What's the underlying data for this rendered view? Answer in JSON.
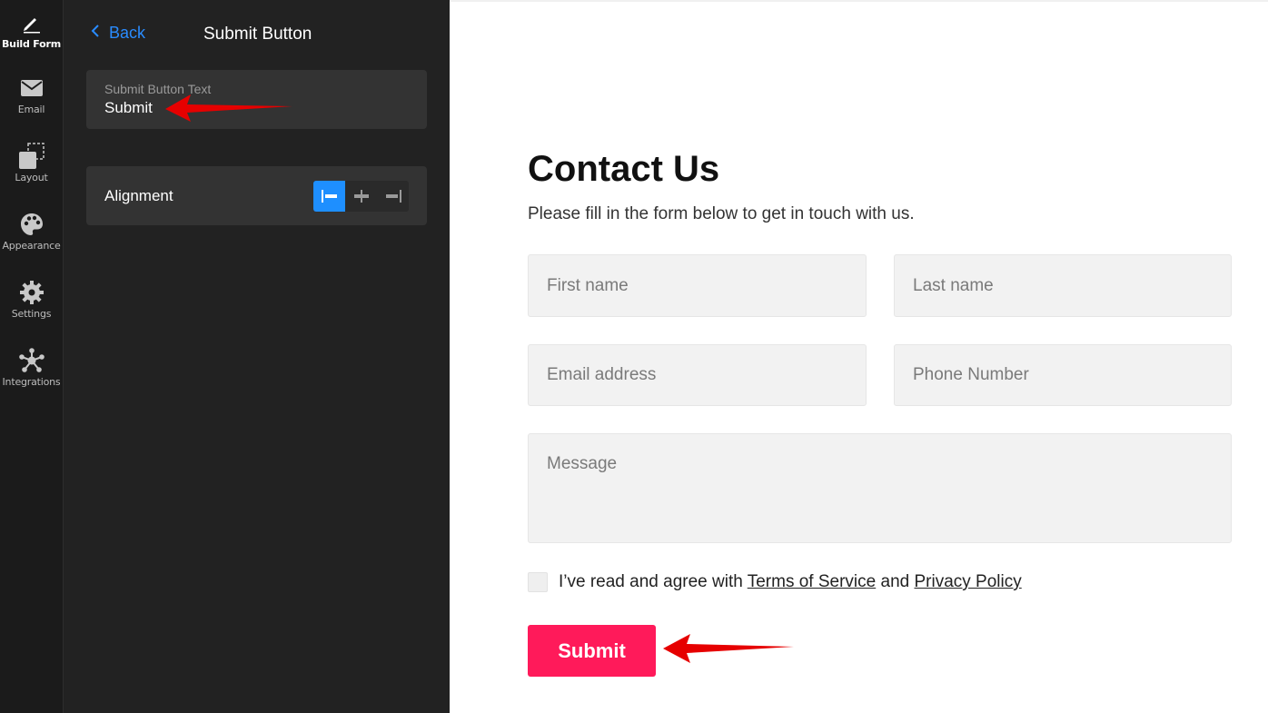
{
  "rail": {
    "items": [
      {
        "label": "Build Form",
        "icon": "pencil-icon",
        "active": true
      },
      {
        "label": "Email",
        "icon": "envelope-icon"
      },
      {
        "label": "Layout",
        "icon": "layout-icon"
      },
      {
        "label": "Appearance",
        "icon": "palette-icon"
      },
      {
        "label": "Settings",
        "icon": "gear-icon"
      },
      {
        "label": "Integrations",
        "icon": "integrations-icon"
      }
    ]
  },
  "panel": {
    "back_label": "Back",
    "title": "Submit Button",
    "button_text_caption": "Submit Button Text",
    "button_text_value": "Submit",
    "alignment_label": "Alignment",
    "alignment_selected": "left"
  },
  "form": {
    "title": "Contact Us",
    "subtitle": "Please fill in the form below to get in touch with us.",
    "first_name_placeholder": "First name",
    "last_name_placeholder": "Last name",
    "email_placeholder": "Email address",
    "phone_placeholder": "Phone Number",
    "message_placeholder": "Message",
    "agree_prefix": "I’ve read and agree with",
    "terms_link": "Terms of Service",
    "agree_and": "and",
    "privacy_link": "Privacy Policy",
    "submit_label": "Submit"
  },
  "colors": {
    "accent_blue": "#1e8fff",
    "submit_pink": "#ff1a5a",
    "annotation_red": "#e60000"
  }
}
